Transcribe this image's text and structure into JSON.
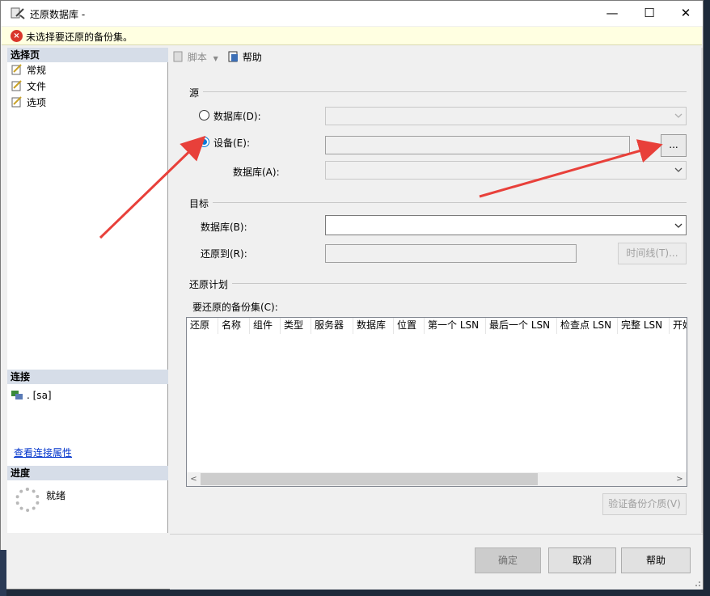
{
  "window": {
    "title": "还原数据库 -",
    "minimize_glyph": "—",
    "maximize_glyph": "☐",
    "close_glyph": "✕"
  },
  "message_bar": {
    "icon": "error-icon",
    "text": "未选择要还原的备份集。"
  },
  "left_pane": {
    "select_page_header": "选择页",
    "pages": [
      {
        "label": "常规",
        "icon": "page-icon"
      },
      {
        "label": "文件",
        "icon": "page-icon"
      },
      {
        "label": "选项",
        "icon": "page-icon"
      }
    ],
    "connection_header": "连接",
    "connection_name": ". [sa]",
    "connection_link": "查看连接属性",
    "progress_header": "进度",
    "progress_status": "就绪"
  },
  "toolbar": {
    "script_label": "脚本",
    "help_label": "帮助"
  },
  "source": {
    "group_label": "源",
    "database_radio_label": "数据库(D):",
    "device_radio_label": "设备(E):",
    "device_value": "",
    "browse_label": "...",
    "sub_database_label": "数据库(A):",
    "selected": "device"
  },
  "destination": {
    "group_label": "目标",
    "database_label": "数据库(B):",
    "database_value": "",
    "restore_to_label": "还原到(R):",
    "restore_to_value": "",
    "timeline_label": "时间线(T)..."
  },
  "restore_plan": {
    "group_label": "还原计划",
    "backup_sets_label": "要还原的备份集(C):",
    "columns": [
      "还原",
      "名称",
      "组件",
      "类型",
      "服务器",
      "数据库",
      "位置",
      "第一个 LSN",
      "最后一个 LSN",
      "检查点 LSN",
      "完整 LSN",
      "开始"
    ],
    "rows": [],
    "verify_label": "验证备份介质(V)"
  },
  "footer": {
    "ok_label": "确定",
    "cancel_label": "取消",
    "help_label": "帮助"
  },
  "colors": {
    "accent": "#0078d7",
    "error": "#d9362b",
    "annotation_arrow": "#e8403a",
    "message_bar_bg": "#ffffe1"
  }
}
